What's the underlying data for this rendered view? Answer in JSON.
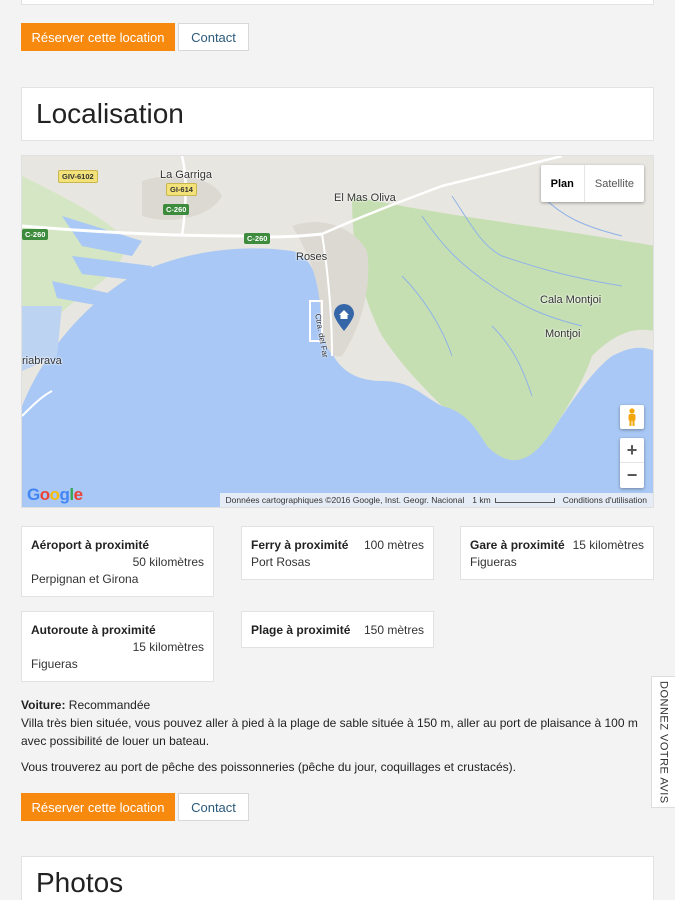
{
  "actions": {
    "reserve_label": "Réserver cette location",
    "contact_label": "Contact"
  },
  "sections": {
    "location_title": "Localisation",
    "photos_title": "Photos"
  },
  "map": {
    "type_plan": "Plan",
    "type_satellite": "Satellite",
    "zoom_in": "+",
    "zoom_out": "−",
    "logo": "Google",
    "attribution": "Données cartographiques ©2016 Google, Inst. Geogr. Nacional",
    "scale": "1 km",
    "terms": "Conditions d'utilisation",
    "icons": [
      "pegman-icon",
      "house-marker-icon"
    ],
    "places": {
      "la_garriga": "La Garriga",
      "el_mas_oliva": "El Mas Oliva",
      "roses": "Roses",
      "cala_montjoi": "Cala Montjoi",
      "montjoi": "Montjoi",
      "riabrava": "riabrava",
      "ctra_del_far": "Ctra. del Far"
    },
    "roads": {
      "giv6102": "GIV-6102",
      "gi614": "GI-614",
      "c260_a": "C-260",
      "c260_b": "C-260",
      "c260_c": "C-260"
    },
    "colors": {
      "water": "#a9c8f5",
      "land": "#e8e6e0",
      "green": "#c6dfb2",
      "marker": "#3466a8"
    }
  },
  "proximity": {
    "airport": {
      "label": "Aéroport à proximité",
      "distance": "50 kilomètres",
      "detail": "Perpignan et Girona"
    },
    "ferry": {
      "label": "Ferry à proximité",
      "distance": "100 mètres",
      "detail": "Port Rosas"
    },
    "train": {
      "label": "Gare à proximité",
      "distance": "15 kilomètres",
      "detail": "Figueras"
    },
    "highway": {
      "label": "Autoroute à proximité",
      "distance": "15 kilomètres",
      "detail": "Figueras"
    },
    "beach": {
      "label": "Plage à proximité",
      "distance": "150 mètres"
    }
  },
  "description": {
    "car_label": "Voiture:",
    "car_value": "Recommandée",
    "text1": "Villa très bien située, vous pouvez aller à pied à la plage de sable située à 150 m, aller au port de plaisance à 100 m avec possibilité de louer un bateau.",
    "text2": "Vous trouverez au port de pêche des poissonneries (pêche du jour, coquillages et crustacés)."
  },
  "feedback_tab": "DONNEZ VOTRE AVIS"
}
